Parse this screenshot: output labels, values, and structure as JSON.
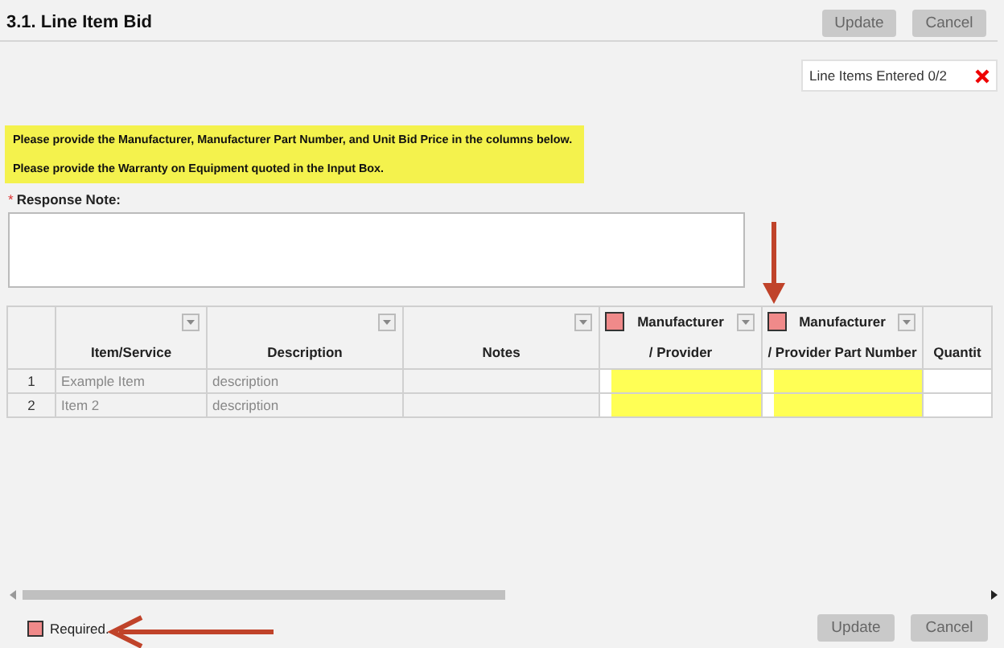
{
  "title": "3.1. Line Item Bid",
  "header_buttons": [
    {
      "label": "Update",
      "disabled": true
    },
    {
      "label": "Cancel",
      "disabled": true
    }
  ],
  "status": {
    "text": "Line Items Entered 0/2",
    "complete": false
  },
  "notice": [
    "Please provide the Manufacturer, Manufacturer Part Number, and Unit Bid Price in the columns below.",
    "Please provide the Warranty on Equipment quoted in the Input Box."
  ],
  "response_note": {
    "label": "Response Note:",
    "required": true,
    "marker": "*"
  },
  "table": {
    "columns": [
      {
        "lines": [
          "Item/Service"
        ],
        "filter": true,
        "required": false
      },
      {
        "lines": [
          "Description"
        ],
        "filter": true,
        "required": false
      },
      {
        "lines": [
          "Notes"
        ],
        "filter": true,
        "required": false
      },
      {
        "lines": [
          "Manufacturer",
          "/ Provider"
        ],
        "filter": true,
        "required": true
      },
      {
        "lines": [
          "Manufacturer",
          "/ Provider Part Number"
        ],
        "filter": true,
        "required": true
      },
      {
        "lines": [
          "Quantit"
        ],
        "filter": false,
        "required": false
      }
    ],
    "rows": [
      {
        "number": "1",
        "cells": [
          "Example Item",
          "description",
          "",
          "",
          "",
          ""
        ]
      },
      {
        "number": "2",
        "cells": [
          "Item 2",
          "description",
          "",
          "",
          "",
          ""
        ]
      }
    ]
  },
  "legend": "Required.",
  "footer_buttons": [
    {
      "label": "Update",
      "disabled": true
    },
    {
      "label": "Cancel",
      "disabled": true
    }
  ]
}
